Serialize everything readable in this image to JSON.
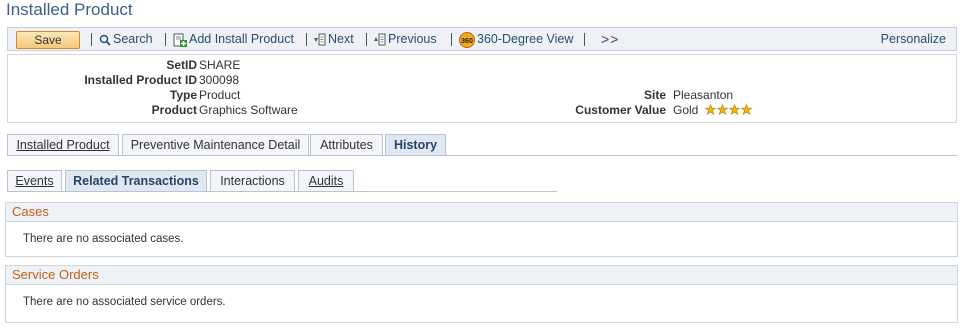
{
  "page": {
    "title": "Installed Product"
  },
  "toolbar": {
    "save_label": "Save",
    "search_label": "Search",
    "add_label": "Add Install Product",
    "next_label": "Next",
    "previous_label": "Previous",
    "view360_badge": "360",
    "view360_label": "360-Degree View",
    "more_label": ">>",
    "personalize_label": "Personalize"
  },
  "header": {
    "setid": {
      "label": "SetID",
      "value": "SHARE"
    },
    "installed_product_id": {
      "label": "Installed Product ID",
      "value": "300098"
    },
    "type": {
      "label": "Type",
      "value": "Product"
    },
    "product": {
      "label": "Product",
      "value": "Graphics Software"
    },
    "site": {
      "label": "Site",
      "value": "Pleasanton"
    },
    "customer_value": {
      "label": "Customer Value",
      "value": "Gold",
      "stars": 4
    }
  },
  "tabs": [
    {
      "label": "Installed Product"
    },
    {
      "label": "Preventive Maintenance Detail"
    },
    {
      "label": "Attributes"
    },
    {
      "label": "History",
      "active": true
    }
  ],
  "subtabs": [
    {
      "label": "Events"
    },
    {
      "label": "Related Transactions",
      "active": true
    },
    {
      "label": "Interactions"
    },
    {
      "label": "Audits"
    }
  ],
  "sections": {
    "cases": {
      "title": "Cases",
      "text": "There are no associated cases."
    },
    "service_orders": {
      "title": "Service Orders",
      "text": "There are no associated service orders."
    }
  },
  "colors": {
    "title": "#3a5f8a",
    "link": "#2b4d73",
    "section_title": "#c2601a",
    "star": "#f2b705"
  },
  "icons": [
    "search-icon",
    "add-icon",
    "next-icon",
    "previous-icon",
    "360-view-icon",
    "star-icon"
  ]
}
